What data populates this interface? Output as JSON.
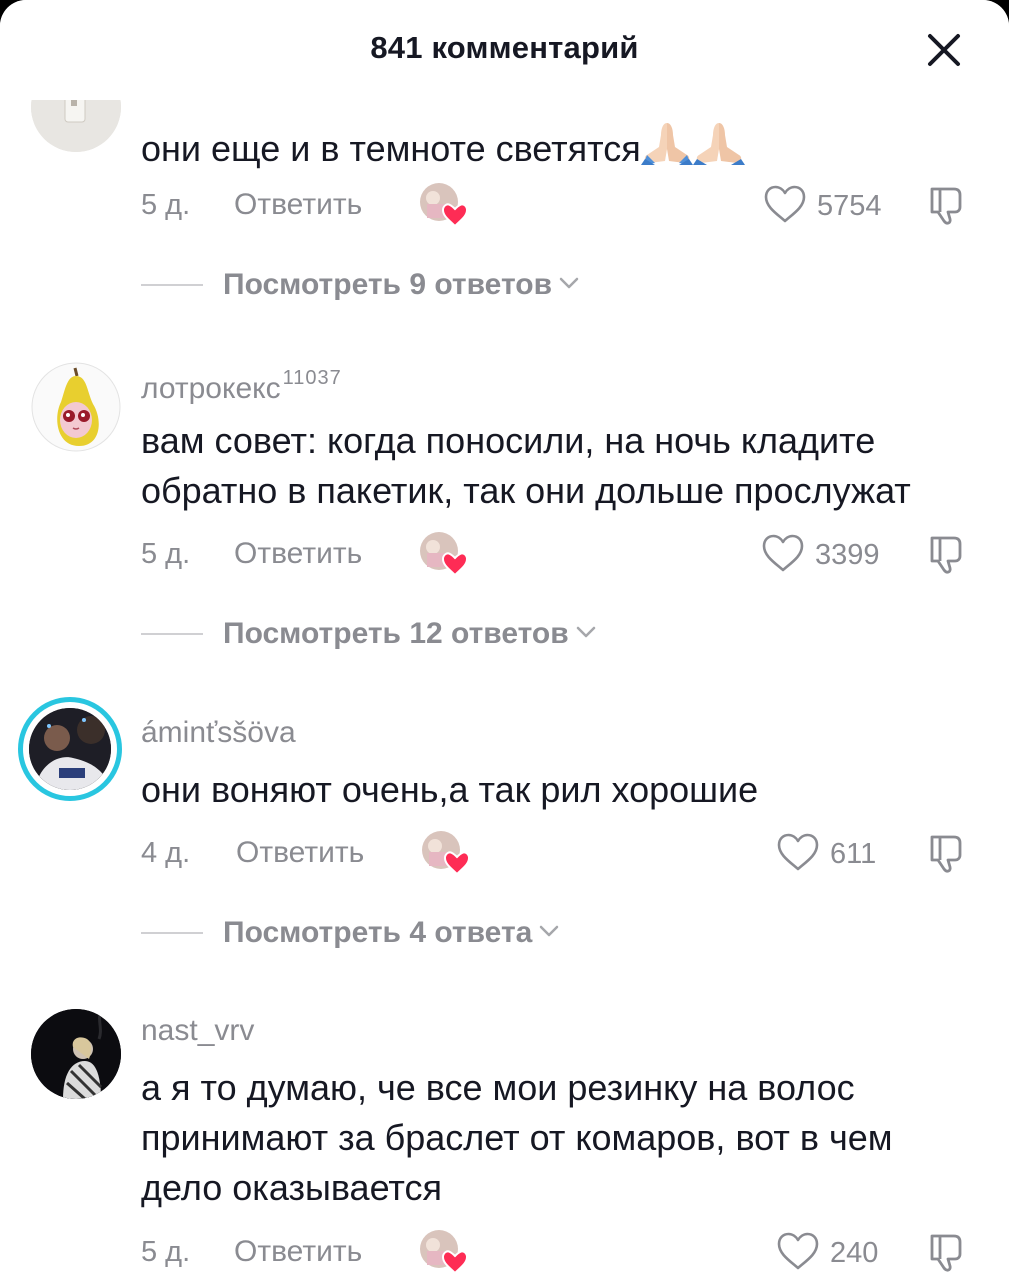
{
  "header": {
    "title": "841 комментарий",
    "close_icon": "close-icon"
  },
  "colors": {
    "text_primary": "#161823",
    "text_secondary": "#8a8b91",
    "like_heart_badge": "#fe2c55",
    "story_ring": "#29c6e0"
  },
  "comments": [
    {
      "username": "",
      "text": "они еще и в темноте светятся",
      "emoji": "🙏🏻🙏🏻",
      "time": "5 д.",
      "reply": "Ответить",
      "likes": "5754",
      "view_replies": "Посмотреть 9 ответов"
    },
    {
      "username": "лотрокекс",
      "username_sup": "11037",
      "text": "вам совет: когда поносили, на ночь кладите обратно в пакетик, так они дольше прослужат",
      "time": "5 д.",
      "reply": "Ответить",
      "likes": "3399",
      "view_replies": "Посмотреть 12 ответов"
    },
    {
      "username": "áminťsšöva",
      "text": "они воняют очень,а так рил хорошие",
      "time": "4 д.",
      "reply": "Ответить",
      "likes": "611",
      "view_replies": "Посмотреть 4 ответа"
    },
    {
      "username": "nast_vrv",
      "text": "а я то думаю, че все мои резинку на волос принимают за браслет от комаров, вот в чем дело оказывается",
      "time": "5 д.",
      "reply": "Ответить",
      "likes": "240"
    }
  ]
}
